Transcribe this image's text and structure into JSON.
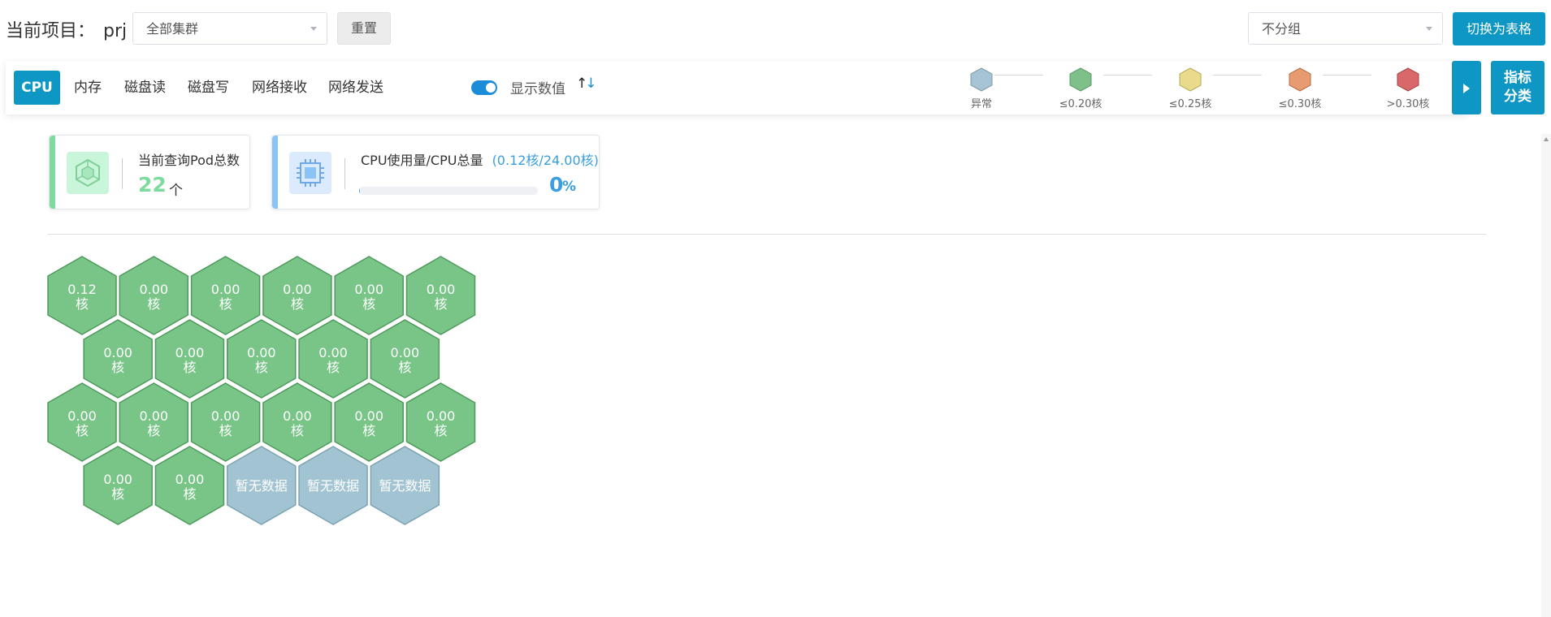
{
  "header": {
    "project_label": "当前项目：",
    "project_name": "prj",
    "cluster_select": "全部集群",
    "reset_label": "重置",
    "group_select": "不分组",
    "switch_label": "切换为表格"
  },
  "toolbar": {
    "tabs": [
      {
        "label": "CPU",
        "active": true
      },
      {
        "label": "内存"
      },
      {
        "label": "磁盘读"
      },
      {
        "label": "磁盘写"
      },
      {
        "label": "网络接收"
      },
      {
        "label": "网络发送"
      }
    ],
    "toggle_label": "显示数值",
    "toggle_on": true,
    "sort_icon": "sort-up-down-icon",
    "legend": [
      {
        "label": "异常",
        "color": "#a7c4d4"
      },
      {
        "label": "≤0.20核",
        "color": "#7fbf8a"
      },
      {
        "label": "≤0.25核",
        "color": "#e8dc8c"
      },
      {
        "label": "≤0.30核",
        "color": "#e89a70"
      },
      {
        "label": ">0.30核",
        "color": "#d9686a"
      }
    ],
    "classify_label_1": "指标",
    "classify_label_2": "分类"
  },
  "cards": {
    "pod": {
      "title": "当前查询Pod总数",
      "value": "22",
      "unit": "个",
      "accent": "#7ddb9f"
    },
    "cpu": {
      "title": "CPU使用量/CPU总量",
      "detail": "(0.12核/24.00核)",
      "value": "0",
      "unit": "%",
      "progress": 0.005,
      "accent": "#8cc3f5"
    }
  },
  "hexes": {
    "colors": {
      "ok": "#78c587",
      "ok_stroke": "#4e9a5c",
      "nodata": "#a2c4d2",
      "nodata_stroke": "#7ba3b3"
    },
    "rows": [
      [
        {
          "line1": "0.12",
          "line2": "核",
          "status": "ok"
        },
        {
          "line1": "0.00",
          "line2": "核",
          "status": "ok"
        },
        {
          "line1": "0.00",
          "line2": "核",
          "status": "ok"
        },
        {
          "line1": "0.00",
          "line2": "核",
          "status": "ok"
        },
        {
          "line1": "0.00",
          "line2": "核",
          "status": "ok"
        },
        {
          "line1": "0.00",
          "line2": "核",
          "status": "ok"
        }
      ],
      [
        {
          "line1": "0.00",
          "line2": "核",
          "status": "ok"
        },
        {
          "line1": "0.00",
          "line2": "核",
          "status": "ok"
        },
        {
          "line1": "0.00",
          "line2": "核",
          "status": "ok"
        },
        {
          "line1": "0.00",
          "line2": "核",
          "status": "ok"
        },
        {
          "line1": "0.00",
          "line2": "核",
          "status": "ok"
        }
      ],
      [
        {
          "line1": "0.00",
          "line2": "核",
          "status": "ok"
        },
        {
          "line1": "0.00",
          "line2": "核",
          "status": "ok"
        },
        {
          "line1": "0.00",
          "line2": "核",
          "status": "ok"
        },
        {
          "line1": "0.00",
          "line2": "核",
          "status": "ok"
        },
        {
          "line1": "0.00",
          "line2": "核",
          "status": "ok"
        },
        {
          "line1": "0.00",
          "line2": "核",
          "status": "ok"
        }
      ],
      [
        {
          "line1": "0.00",
          "line2": "核",
          "status": "ok"
        },
        {
          "line1": "0.00",
          "line2": "核",
          "status": "ok"
        },
        {
          "line1": "暂无数据",
          "line2": "",
          "status": "nodata"
        },
        {
          "line1": "暂无数据",
          "line2": "",
          "status": "nodata"
        },
        {
          "line1": "暂无数据",
          "line2": "",
          "status": "nodata"
        }
      ]
    ]
  }
}
